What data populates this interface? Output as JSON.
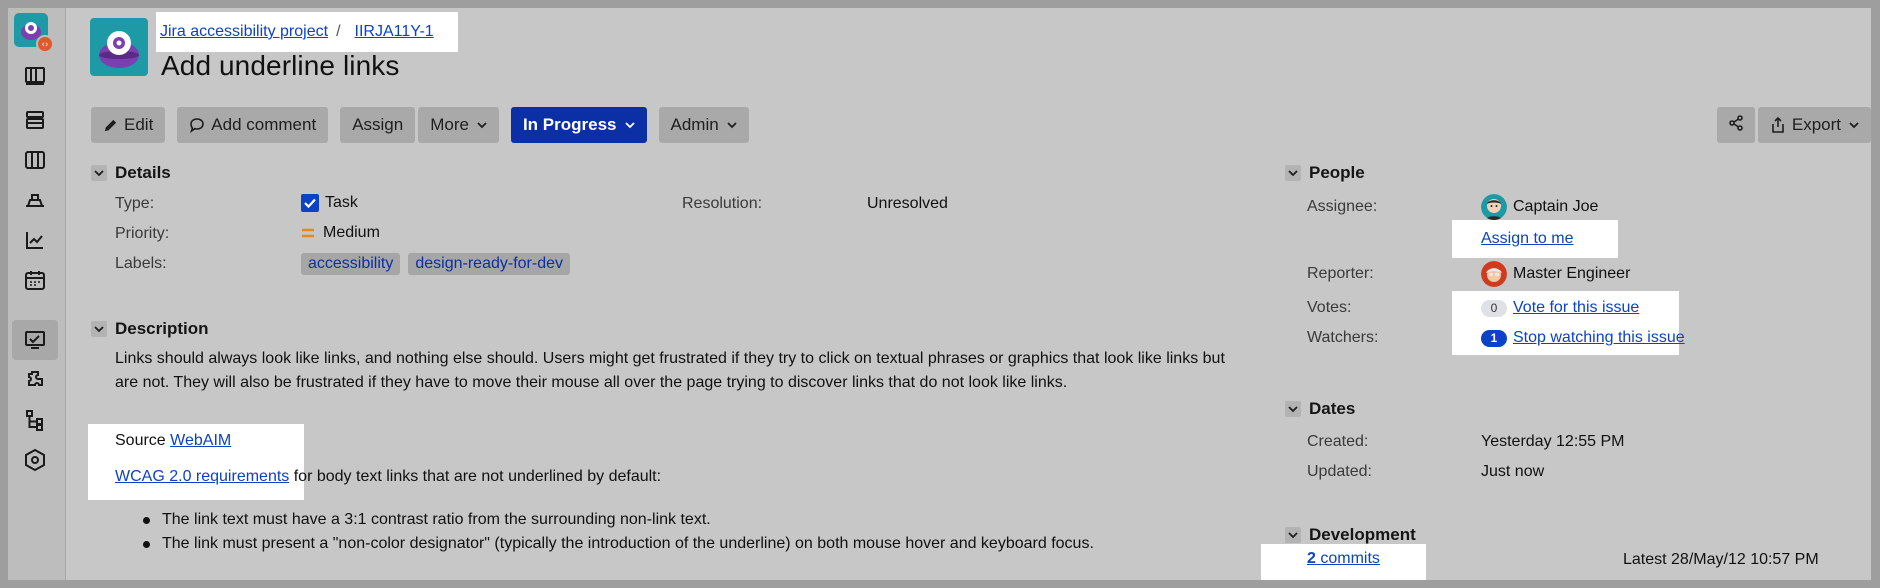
{
  "breadcrumb": {
    "project": "Jira accessibility project",
    "separator": "/",
    "issue_key": "IIRJA11Y-1"
  },
  "issue": {
    "title": "Add underline links"
  },
  "toolbar": {
    "edit": "Edit",
    "add_comment": "Add comment",
    "assign": "Assign",
    "more": "More",
    "status": "In Progress",
    "admin": "Admin",
    "export": "Export"
  },
  "details": {
    "heading": "Details",
    "type_label": "Type:",
    "type_value": "Task",
    "priority_label": "Priority:",
    "priority_value": "Medium",
    "labels_label": "Labels:",
    "labels": [
      "accessibility",
      "design-ready-for-dev"
    ],
    "resolution_label": "Resolution:",
    "resolution_value": "Unresolved"
  },
  "description": {
    "heading": "Description",
    "paragraph": "Links should always look like links, and nothing else should. Users might get frustrated if they try to click on textual phrases or graphics that look like links but are not. They will also be frustrated if they have to move their mouse all over the page trying to discover links that do not look like links.",
    "source_prefix": "Source",
    "source_link": "WebAIM",
    "wcag_link": "WCAG 2.0 requirements",
    "wcag_suffix": "for body text links that are not underlined by default:",
    "bullets": [
      "The link text must have a 3:1 contrast ratio from the surrounding non-link text.",
      "The link must present a \"non-color designator\" (typically the introduction of the underline) on both mouse hover and keyboard focus."
    ]
  },
  "people": {
    "heading": "People",
    "assignee_label": "Assignee:",
    "assignee_name": "Captain Joe",
    "assign_to_me": "Assign to me",
    "reporter_label": "Reporter:",
    "reporter_name": "Master Engineer",
    "votes_label": "Votes:",
    "votes_count": "0",
    "vote_link": "Vote for this issue",
    "watchers_label": "Watchers:",
    "watchers_count": "1",
    "watch_link": "Stop watching this issue"
  },
  "dates": {
    "heading": "Dates",
    "created_label": "Created:",
    "created_value": "Yesterday 12:55 PM",
    "updated_label": "Updated:",
    "updated_value": "Just now"
  },
  "development": {
    "heading": "Development",
    "commits_count": "2",
    "commits_word": "commits",
    "latest": "Latest 28/May/12 10:57 PM"
  },
  "colors": {
    "primary": "#0b2fa5",
    "link": "#0b43c4",
    "highlight": "#ffffff"
  }
}
